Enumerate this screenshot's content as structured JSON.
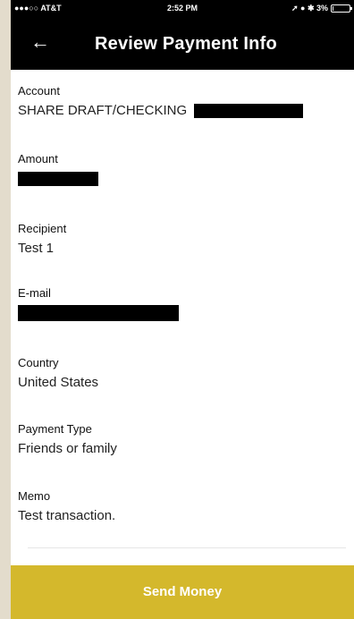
{
  "status_bar": {
    "carrier": "●●●○○ AT&T",
    "time": "2:52 PM",
    "indicators": "➚ ● ✱ 3%",
    "battery_level": 0.03
  },
  "header": {
    "back_icon": "←",
    "title": "Review Payment Info"
  },
  "fields": {
    "account": {
      "label": "Account",
      "value": "SHARE DRAFT/CHECKING"
    },
    "amount": {
      "label": "Amount"
    },
    "recipient": {
      "label": "Recipient",
      "value": "Test 1"
    },
    "email": {
      "label": "E-mail"
    },
    "country": {
      "label": "Country",
      "value": "United States"
    },
    "payment_type": {
      "label": "Payment Type",
      "value": "Friends or family"
    },
    "memo": {
      "label": "Memo",
      "value": "Test transaction."
    }
  },
  "actions": {
    "send_label": "Send Money"
  },
  "colors": {
    "header_bg": "#000000",
    "button_bg": "#d4b82c",
    "page_bg": "#e3dccc"
  }
}
